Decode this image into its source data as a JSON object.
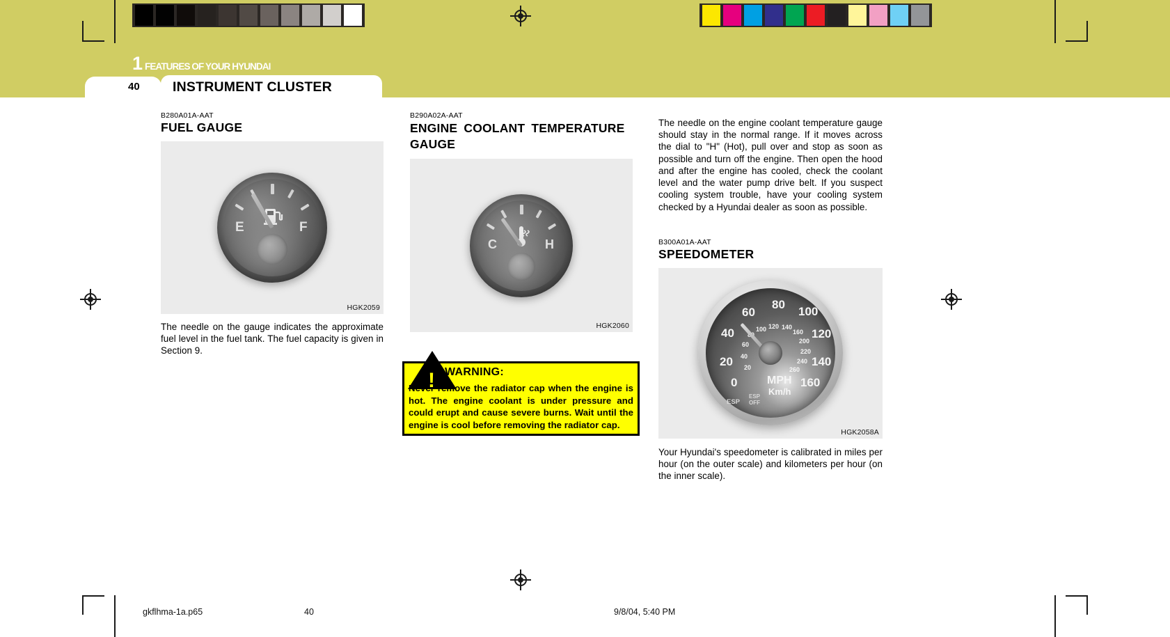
{
  "page": {
    "chapter_number": "1",
    "chapter_title": "FEATURES OF YOUR HYUNDAI",
    "page_number": "40",
    "section_title": "INSTRUMENT CLUSTER"
  },
  "calibration": {
    "gray_swatches": [
      "#000000",
      "#020202",
      "#100c0a",
      "#26221f",
      "#3c3531",
      "#514a45",
      "#6a625e",
      "#8b8481",
      "#aeaaa6",
      "#d2cfcc",
      "#ffffff"
    ],
    "color_swatches": [
      "#fce700",
      "#e6007e",
      "#00a0e3",
      "#312f8c",
      "#00a551",
      "#ec1c24",
      "#232021",
      "#fff59a",
      "#f2a0c4",
      "#6fd0f5",
      "#939598"
    ]
  },
  "left_column": {
    "section_code": "B280A01A-AAT",
    "section_title": "FUEL GAUGE",
    "figure_code": "HGK2059",
    "gauge": {
      "label_left": "E",
      "label_right": "F",
      "icon": "fuel-pump-icon"
    },
    "body": "The needle on the gauge indicates the approximate fuel level in the fuel tank. The fuel capacity is given in Section 9."
  },
  "middle_column": {
    "section_code": "B290A02A-AAT",
    "section_title": "ENGINE COOLANT TEMPERATURE GAUGE",
    "figure_code": "HGK2060",
    "gauge": {
      "label_left": "C",
      "label_right": "H",
      "icon": "coolant-temperature-icon"
    },
    "warning": {
      "title": "WARNING:",
      "icon": "warning-triangle-icon",
      "text": "Never remove the radiator cap when the engine is hot. The engine coolant is under pressure and could erupt and cause severe burns. Wait until the engine is cool before removing the radiator cap."
    }
  },
  "right_column": {
    "intro_text": "The needle on the engine coolant temperature gauge should stay in the normal range. If it moves across the dial to \"H\" (Hot), pull over and stop as soon as possible and turn off the engine. Then open the hood and after the engine has cooled,  check the coolant level and the water pump drive belt. If you suspect cooling system trouble, have your cooling system checked by a Hyundai dealer as soon as possible.",
    "section_code": "B300A01A-AAT",
    "section_title": "SPEEDOMETER",
    "figure_code": "HGK2058A",
    "speedometer": {
      "mph_unit": "MPH",
      "kmh_unit": "Km/h",
      "mph_labels": [
        "0",
        "20",
        "40",
        "60",
        "80",
        "100",
        "120",
        "140",
        "160"
      ],
      "kmh_labels": [
        "20",
        "40",
        "60",
        "80",
        "100",
        "120",
        "140",
        "160",
        "200",
        "220",
        "240",
        "260"
      ],
      "esp_label": "ESP",
      "esp_off_label": "ESP OFF"
    },
    "body": "Your Hyundai's speedometer is calibrated in miles per hour (on the outer scale) and kilometers per hour (on the inner scale)."
  },
  "footer": {
    "file_name": "gkflhma-1a.p65",
    "page_number": "40",
    "timestamp": "9/8/04, 5:40 PM"
  }
}
